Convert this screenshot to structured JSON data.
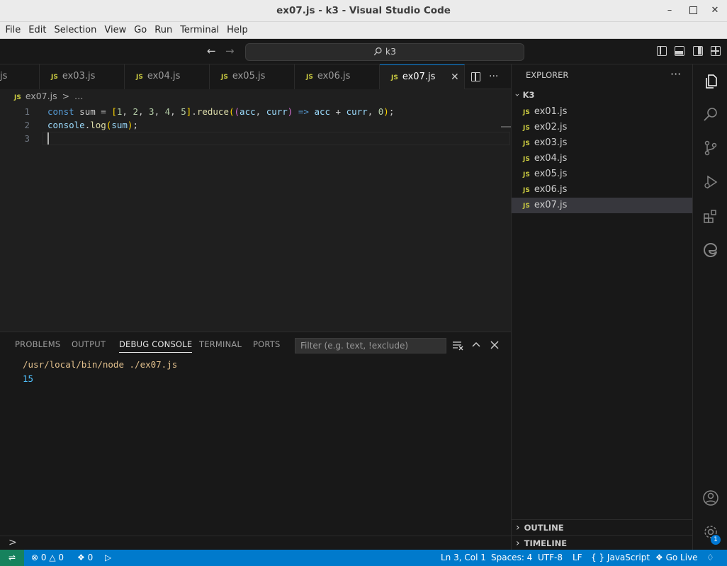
{
  "window": {
    "title": "ex07.js - k3 - Visual Studio Code"
  },
  "menu": [
    "File",
    "Edit",
    "Selection",
    "View",
    "Go",
    "Run",
    "Terminal",
    "Help"
  ],
  "command_center": {
    "search_text": "k3"
  },
  "tabs": [
    {
      "label": "js",
      "partial": true
    },
    {
      "label": "ex03.js",
      "badge": "JS"
    },
    {
      "label": "ex04.js",
      "badge": "JS"
    },
    {
      "label": "ex05.js",
      "badge": "JS"
    },
    {
      "label": "ex06.js",
      "badge": "JS"
    },
    {
      "label": "ex07.js",
      "badge": "JS",
      "active": true
    }
  ],
  "breadcrumb": {
    "badge": "JS",
    "file": "ex07.js",
    "sep": ">",
    "more": "…"
  },
  "editor": {
    "line_numbers": [
      "1",
      "2",
      "3"
    ],
    "line1": {
      "t1": "const",
      "t2": " sum = ",
      "t3": "[",
      "t4": "1",
      "t5": ", ",
      "t6": "2",
      "t7": ", ",
      "t8": "3",
      "t9": ", ",
      "t10": "4",
      "t11": ", ",
      "t12": "5",
      "t13": "]",
      "t14": ".",
      "t15": "reduce",
      "t16": "(",
      "t17": "(",
      "t18": "acc",
      "t19": ", ",
      "t20": "curr",
      "t21": ")",
      "t22": " => ",
      "t23": "acc",
      "t24": " + ",
      "t25": "curr",
      "t26": ", ",
      "t27": "0",
      "t28": ")",
      "t29": ";"
    },
    "line2": {
      "t1": "console",
      "t2": ".",
      "t3": "log",
      "t4": "(",
      "t5": "sum",
      "t6": ")",
      "t7": ";"
    }
  },
  "panel": {
    "tabs": [
      "PROBLEMS",
      "OUTPUT",
      "DEBUG CONSOLE",
      "TERMINAL",
      "PORTS"
    ],
    "active_tab": "DEBUG CONSOLE",
    "filter_placeholder": "Filter (e.g. text, !exclude)",
    "output": [
      "/usr/local/bin/node ./ex07.js",
      "15"
    ],
    "prompt": ">"
  },
  "explorer": {
    "title": "EXPLORER",
    "more": "···",
    "folder": "K3",
    "files": [
      "ex01.js",
      "ex02.js",
      "ex03.js",
      "ex04.js",
      "ex05.js",
      "ex06.js",
      "ex07.js"
    ],
    "selected_file": "ex07.js",
    "file_badge": "JS",
    "sections": [
      "OUTLINE",
      "TIMELINE"
    ]
  },
  "activity": {
    "badge_count": "1"
  },
  "statusbar": {
    "errors": "0",
    "warnings": "0",
    "ports": "0",
    "position": "Ln 3, Col 1",
    "spaces": "Spaces: 4",
    "encoding": "UTF-8",
    "eol": "LF",
    "language_braces": "{ }",
    "language": "JavaScript",
    "golive": "Go Live"
  },
  "colors": {
    "accent": "#0078d4",
    "statusbar": "#007acc",
    "remote": "#16825d",
    "js_badge": "#cbcb41"
  }
}
